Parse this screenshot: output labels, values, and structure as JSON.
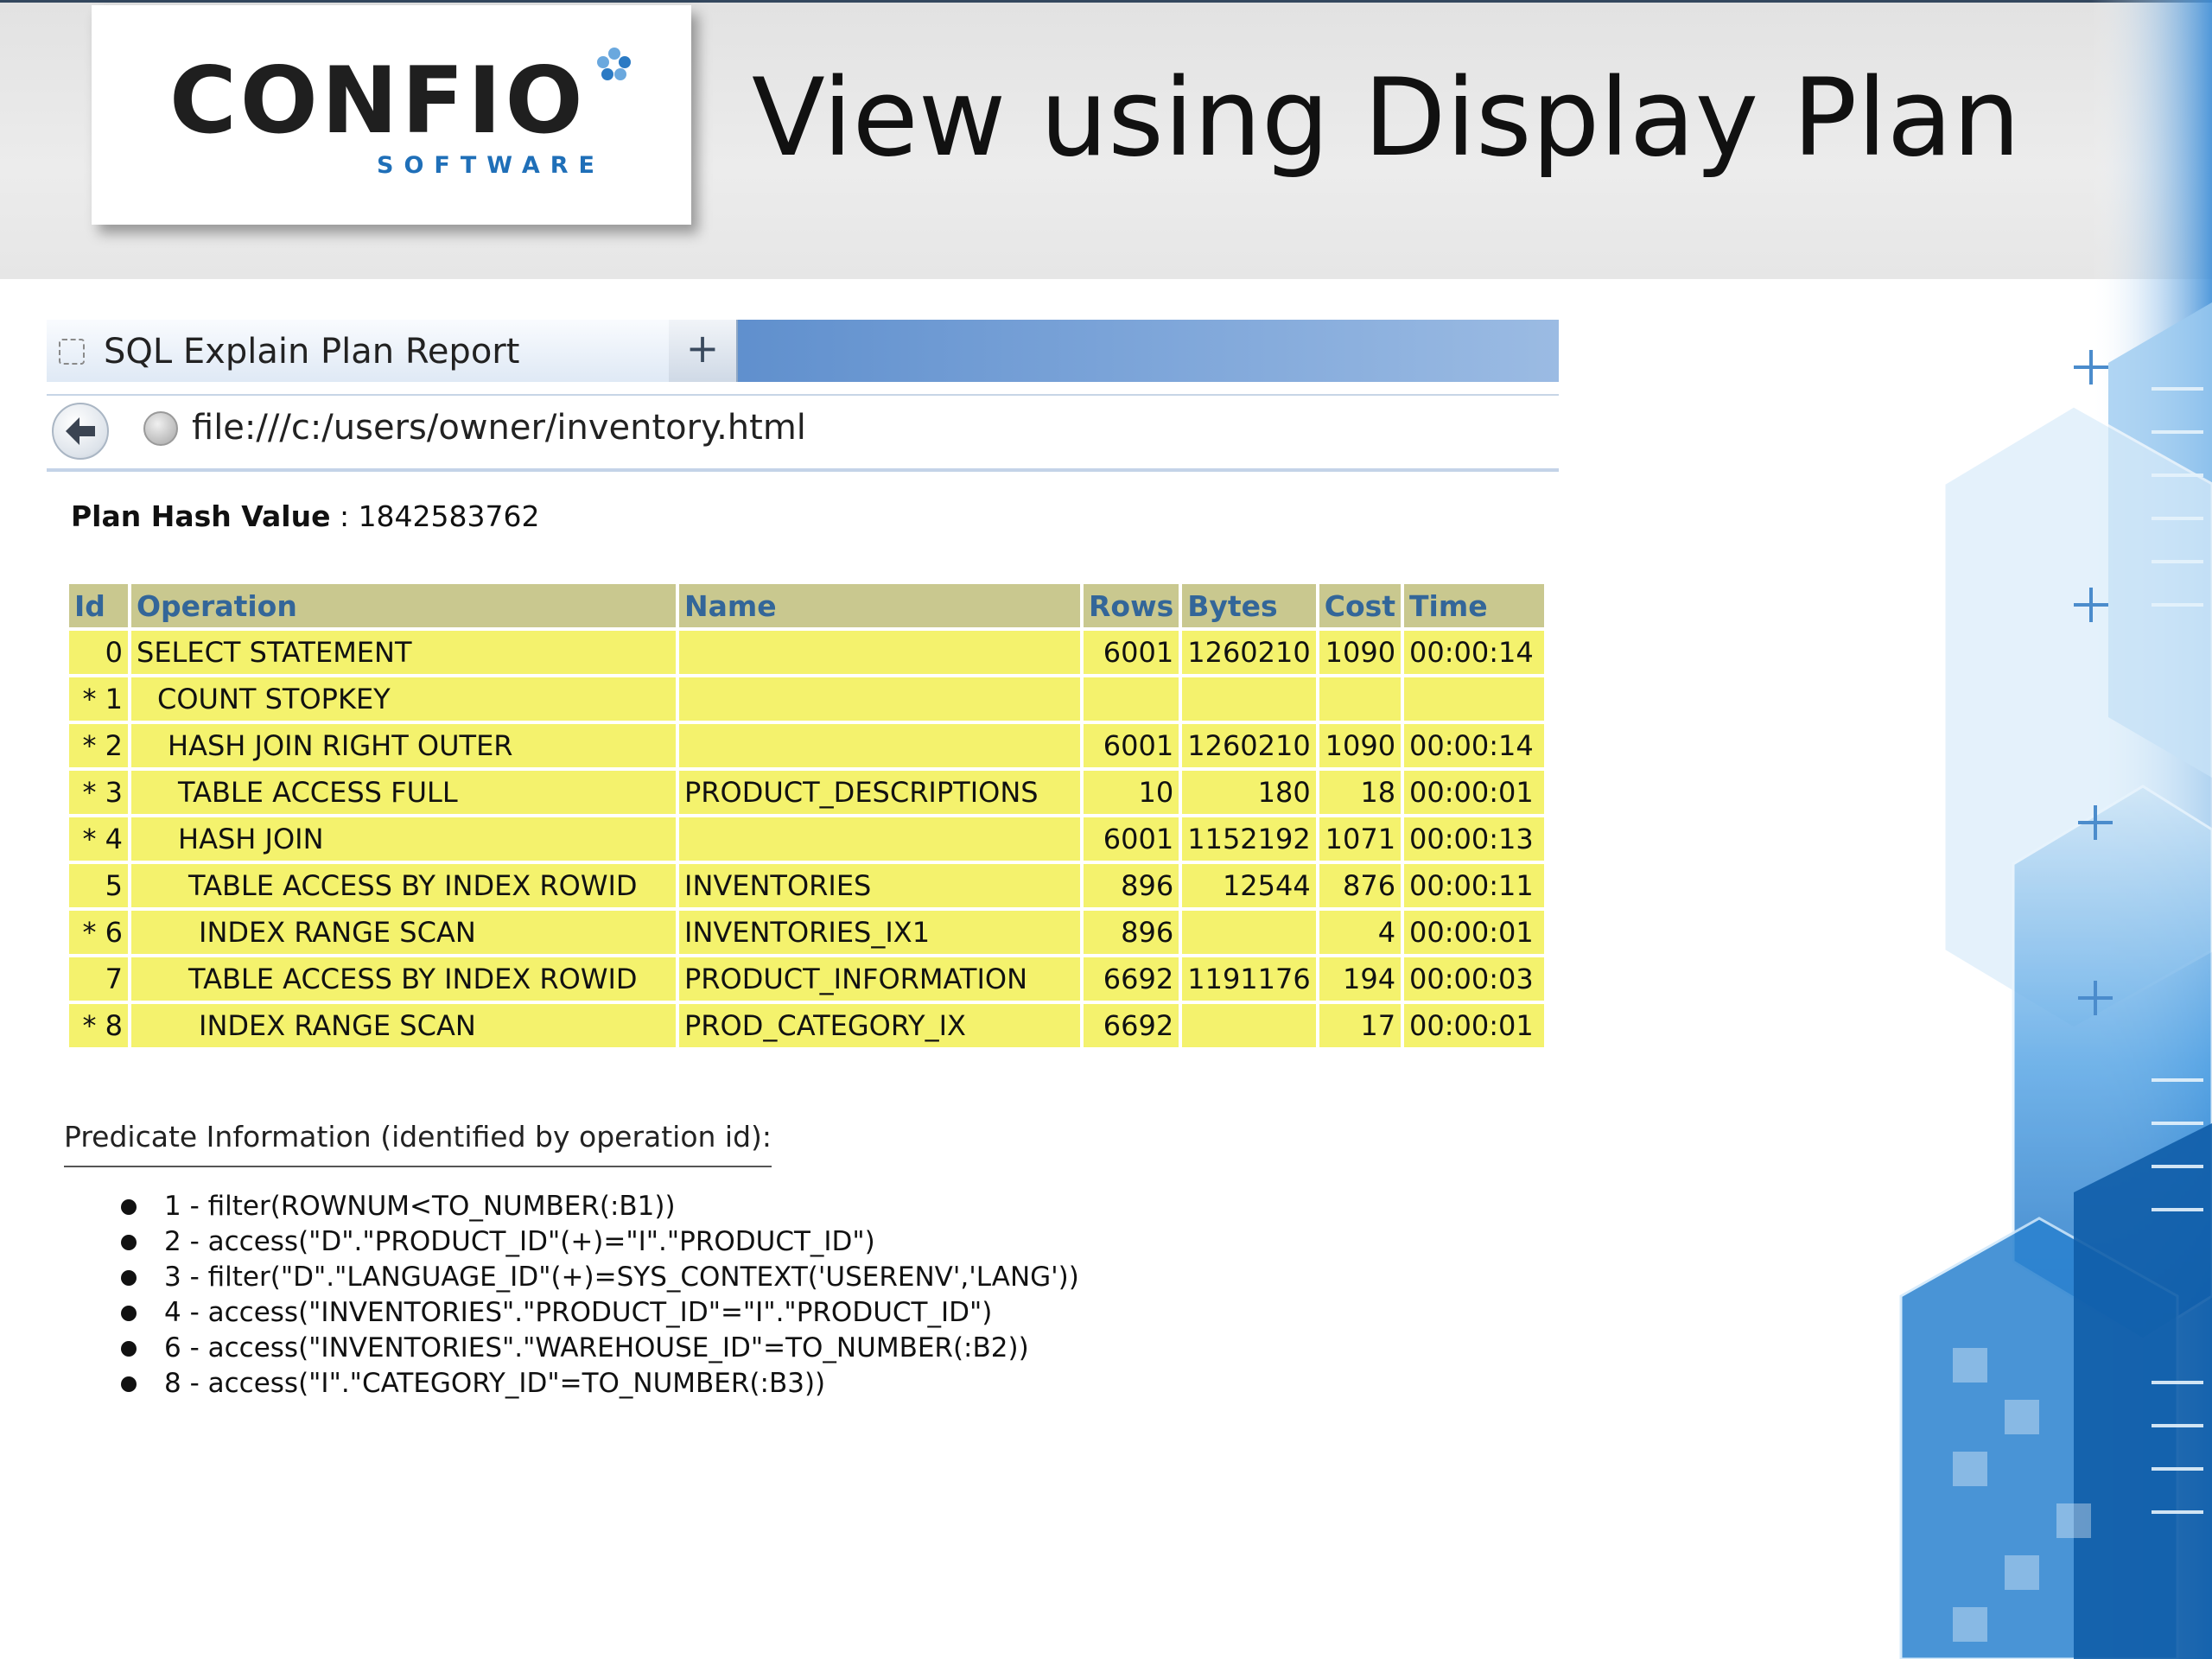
{
  "slide": {
    "logo_word": "CONFIO",
    "logo_sub": "SOFTWARE",
    "title": "View using Display Plan"
  },
  "browser": {
    "tab_title": "SQL Explain Plan Report",
    "new_tab_label": "+",
    "url": "file:///c:/users/owner/inventory.html"
  },
  "report": {
    "plan_hash_label": "Plan Hash Value",
    "plan_hash_sep": " : ",
    "plan_hash_value": "1842583762",
    "columns": [
      "Id",
      "Operation",
      "Name",
      "Rows",
      "Bytes",
      "Cost",
      "Time"
    ],
    "rows": [
      {
        "id": "0",
        "op": "SELECT STATEMENT",
        "name": "",
        "rows": "6001",
        "bytes": "1260210",
        "cost": "1090",
        "time": "00:00:14"
      },
      {
        "id": "* 1",
        "op": "COUNT STOPKEY",
        "name": "",
        "rows": "",
        "bytes": "",
        "cost": "",
        "time": ""
      },
      {
        "id": "* 2",
        "op": "HASH JOIN RIGHT OUTER",
        "name": "",
        "rows": "6001",
        "bytes": "1260210",
        "cost": "1090",
        "time": "00:00:14"
      },
      {
        "id": "* 3",
        "op": "TABLE ACCESS FULL",
        "name": "PRODUCT_DESCRIPTIONS",
        "rows": "10",
        "bytes": "180",
        "cost": "18",
        "time": "00:00:01"
      },
      {
        "id": "* 4",
        "op": "HASH JOIN",
        "name": "",
        "rows": "6001",
        "bytes": "1152192",
        "cost": "1071",
        "time": "00:00:13"
      },
      {
        "id": "5",
        "op": "TABLE ACCESS BY INDEX ROWID",
        "name": "INVENTORIES",
        "rows": "896",
        "bytes": "12544",
        "cost": "876",
        "time": "00:00:11"
      },
      {
        "id": "* 6",
        "op": "INDEX RANGE SCAN",
        "name": "INVENTORIES_IX1",
        "rows": "896",
        "bytes": "",
        "cost": "4",
        "time": "00:00:01"
      },
      {
        "id": "7",
        "op": "TABLE ACCESS BY INDEX ROWID",
        "name": "PRODUCT_INFORMATION",
        "rows": "6692",
        "bytes": "1191176",
        "cost": "194",
        "time": "00:00:03"
      },
      {
        "id": "* 8",
        "op": "INDEX RANGE SCAN",
        "name": "PROD_CATEGORY_IX",
        "rows": "6692",
        "bytes": "",
        "cost": "17",
        "time": "00:00:01"
      }
    ],
    "predicate_title": "Predicate Information (identified by operation id):",
    "predicates": [
      "1 - filter(ROWNUM<TO_NUMBER(:B1))",
      "2 - access(\"D\".\"PRODUCT_ID\"(+)=\"I\".\"PRODUCT_ID\")",
      "3 - filter(\"D\".\"LANGUAGE_ID\"(+)=SYS_CONTEXT('USERENV','LANG'))",
      "4 - access(\"INVENTORIES\".\"PRODUCT_ID\"=\"I\".\"PRODUCT_ID\")",
      "6 - access(\"INVENTORIES\".\"WAREHOUSE_ID\"=TO_NUMBER(:B2))",
      "8 - access(\"I\".\"CATEGORY_ID\"=TO_NUMBER(:B3))"
    ]
  },
  "colors": {
    "header_cell": "#c9c88f",
    "header_text": "#336699",
    "data_cell": "#f4f26d",
    "brand_blue": "#1f6fb8"
  }
}
